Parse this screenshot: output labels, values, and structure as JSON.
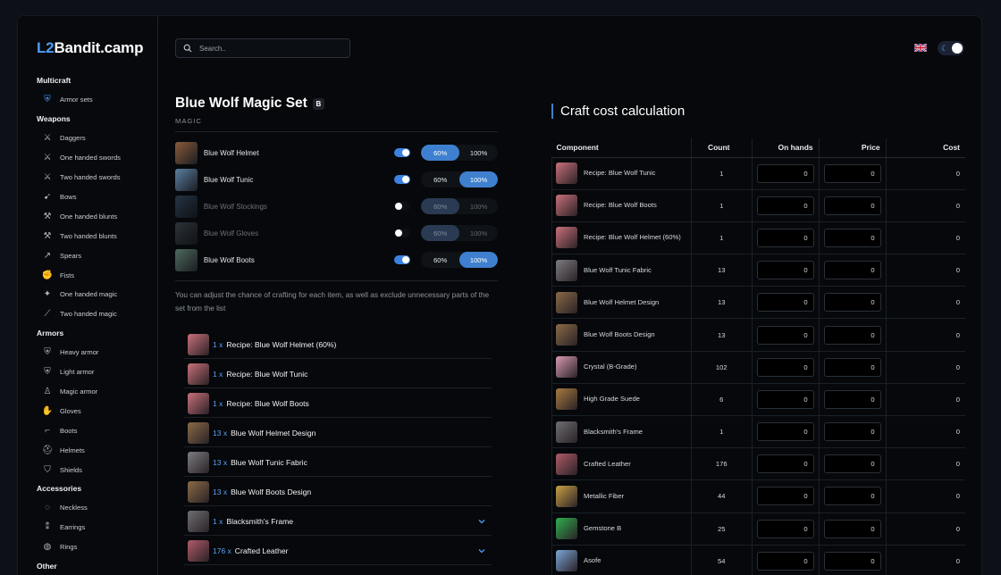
{
  "logo": {
    "prefix": "L2",
    "rest": "Bandit.camp"
  },
  "search": {
    "placeholder": "Search.."
  },
  "sidebar": {
    "sections": [
      {
        "title": "Multicraft",
        "items": [
          {
            "label": "Armor sets",
            "icon": "armor-sets-icon"
          }
        ]
      },
      {
        "title": "Weapons",
        "items": [
          {
            "label": "Daggers",
            "icon": "dagger-icon"
          },
          {
            "label": "One handed swords",
            "icon": "sword-icon"
          },
          {
            "label": "Two handed swords",
            "icon": "two-handed-sword-icon"
          },
          {
            "label": "Bows",
            "icon": "bow-icon"
          },
          {
            "label": "One handed blunts",
            "icon": "blunt-icon"
          },
          {
            "label": "Two handed blunts",
            "icon": "two-handed-blunt-icon"
          },
          {
            "label": "Spears",
            "icon": "spear-icon"
          },
          {
            "label": "Fists",
            "icon": "fist-icon"
          },
          {
            "label": "One handed magic",
            "icon": "magic-icon"
          },
          {
            "label": "Two handed magic",
            "icon": "staff-icon"
          }
        ]
      },
      {
        "title": "Armors",
        "items": [
          {
            "label": "Heavy armor",
            "icon": "heavy-armor-icon"
          },
          {
            "label": "Light armor",
            "icon": "light-armor-icon"
          },
          {
            "label": "Magic armor",
            "icon": "robe-icon"
          },
          {
            "label": "Gloves",
            "icon": "gloves-icon"
          },
          {
            "label": "Boots",
            "icon": "boots-icon"
          },
          {
            "label": "Helmets",
            "icon": "helmet-icon"
          },
          {
            "label": "Shields",
            "icon": "shield-icon"
          }
        ]
      },
      {
        "title": "Accessories",
        "items": [
          {
            "label": "Neckless",
            "icon": "necklace-icon"
          },
          {
            "label": "Earrings",
            "icon": "earrings-icon"
          },
          {
            "label": "Rings",
            "icon": "ring-icon"
          }
        ]
      },
      {
        "title": "Other",
        "items": []
      }
    ]
  },
  "set": {
    "title": "Blue Wolf Magic Set",
    "grade": "B",
    "type": "MAGIC",
    "parts": [
      {
        "name": "Blue Wolf Helmet",
        "enabled": true,
        "low": "60%",
        "high": "100%",
        "selected": "low",
        "color": "#8a5a3a"
      },
      {
        "name": "Blue Wolf Tunic",
        "enabled": true,
        "low": "60%",
        "high": "100%",
        "selected": "high",
        "color": "#5a7fa0"
      },
      {
        "name": "Blue Wolf Stockings",
        "enabled": false,
        "low": "60%",
        "high": "100%",
        "selected": "low",
        "color": "#4a6a88"
      },
      {
        "name": "Blue Wolf Gloves",
        "enabled": false,
        "low": "60%",
        "high": "100%",
        "selected": "low",
        "color": "#5b6770"
      },
      {
        "name": "Blue Wolf Boots",
        "enabled": true,
        "low": "60%",
        "high": "100%",
        "selected": "high",
        "color": "#4e6a5c"
      }
    ],
    "hint": "You can adjust the chance of crafting for each item, as well as exclude unnecessary parts of the set from the list"
  },
  "materials": [
    {
      "qty": "1 x",
      "name": "Recipe: Blue Wolf Helmet (60%)",
      "expandable": false,
      "color": "#c9707a"
    },
    {
      "qty": "1 x",
      "name": "Recipe: Blue Wolf Tunic",
      "expandable": false,
      "color": "#c9707a"
    },
    {
      "qty": "1 x",
      "name": "Recipe: Blue Wolf Boots",
      "expandable": false,
      "color": "#c9707a"
    },
    {
      "qty": "13 x",
      "name": "Blue Wolf Helmet Design",
      "expandable": false,
      "color": "#8a6a45"
    },
    {
      "qty": "13 x",
      "name": "Blue Wolf Tunic Fabric",
      "expandable": false,
      "color": "#7c7c80"
    },
    {
      "qty": "13 x",
      "name": "Blue Wolf Boots Design",
      "expandable": false,
      "color": "#8a6a45"
    },
    {
      "qty": "1 x",
      "name": "Blacksmith's Frame",
      "expandable": true,
      "color": "#6f6f74"
    },
    {
      "qty": "176 x",
      "name": "Crafted Leather",
      "expandable": true,
      "color": "#b05a68"
    }
  ],
  "calc": {
    "title": "Craft cost calculation",
    "columns": {
      "component": "Component",
      "count": "Count",
      "on_hands": "On hands",
      "price": "Price",
      "cost": "Cost"
    },
    "rows": [
      {
        "name": "Recipe: Blue Wolf Tunic",
        "count": "1",
        "on_hands": "0",
        "price": "0",
        "cost": "0",
        "color": "#c9707a"
      },
      {
        "name": "Recipe: Blue Wolf Boots",
        "count": "1",
        "on_hands": "0",
        "price": "0",
        "cost": "0",
        "color": "#c9707a"
      },
      {
        "name": "Recipe: Blue Wolf Helmet (60%)",
        "count": "1",
        "on_hands": "0",
        "price": "0",
        "cost": "0",
        "color": "#c9707a"
      },
      {
        "name": "Blue Wolf Tunic Fabric",
        "count": "13",
        "on_hands": "0",
        "price": "0",
        "cost": "0",
        "color": "#7c7c80"
      },
      {
        "name": "Blue Wolf Helmet Design",
        "count": "13",
        "on_hands": "0",
        "price": "0",
        "cost": "0",
        "color": "#8a6a45"
      },
      {
        "name": "Blue Wolf Boots Design",
        "count": "13",
        "on_hands": "0",
        "price": "0",
        "cost": "0",
        "color": "#8a6a45"
      },
      {
        "name": "Crystal (B-Grade)",
        "count": "102",
        "on_hands": "0",
        "price": "0",
        "cost": "0",
        "color": "#d79ab0"
      },
      {
        "name": "High Grade Suede",
        "count": "6",
        "on_hands": "0",
        "price": "0",
        "cost": "0",
        "color": "#a77a3e"
      },
      {
        "name": "Blacksmith's Frame",
        "count": "1",
        "on_hands": "0",
        "price": "0",
        "cost": "0",
        "color": "#6f6f74"
      },
      {
        "name": "Crafted Leather",
        "count": "176",
        "on_hands": "0",
        "price": "0",
        "cost": "0",
        "color": "#b05a68"
      },
      {
        "name": "Metallic Fiber",
        "count": "44",
        "on_hands": "0",
        "price": "0",
        "cost": "0",
        "color": "#c9a045"
      },
      {
        "name": "Gemstone B",
        "count": "25",
        "on_hands": "0",
        "price": "0",
        "cost": "0",
        "color": "#2fae4e"
      },
      {
        "name": "Asofe",
        "count": "54",
        "on_hands": "0",
        "price": "0",
        "cost": "0",
        "color": "#7aa6d8"
      }
    ]
  },
  "colors": {
    "accent": "#3e80cf",
    "qty": "#5aa2f5",
    "background": "#06080b"
  }
}
